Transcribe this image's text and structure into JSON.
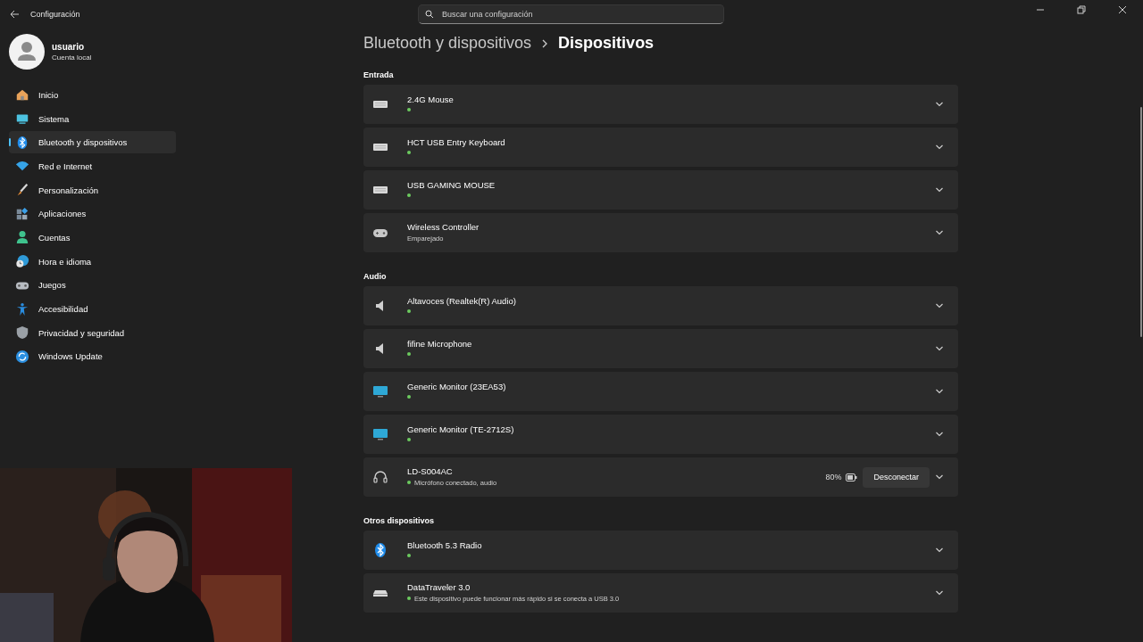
{
  "window": {
    "title": "Configuración"
  },
  "search": {
    "placeholder": "Buscar una configuración"
  },
  "account": {
    "name": "usuario",
    "type": "Cuenta local"
  },
  "sidebar": {
    "items": [
      {
        "label": "Inicio",
        "selected": false
      },
      {
        "label": "Sistema",
        "selected": false
      },
      {
        "label": "Bluetooth y dispositivos",
        "selected": true
      },
      {
        "label": "Red e Internet",
        "selected": false
      },
      {
        "label": "Personalización",
        "selected": false
      },
      {
        "label": "Aplicaciones",
        "selected": false
      },
      {
        "label": "Cuentas",
        "selected": false
      },
      {
        "label": "Hora e idioma",
        "selected": false
      },
      {
        "label": "Juegos",
        "selected": false
      },
      {
        "label": "Accesibilidad",
        "selected": false
      },
      {
        "label": "Privacidad y seguridad",
        "selected": false
      },
      {
        "label": "Windows Update",
        "selected": false
      }
    ]
  },
  "breadcrumb": [
    "Bluetooth y dispositivos",
    "Dispositivos"
  ],
  "sections": [
    {
      "title": "Entrada",
      "devices": [
        {
          "name": "2.4G Mouse",
          "kind": "keyboard",
          "connected": true
        },
        {
          "name": "HCT USB Entry Keyboard",
          "kind": "keyboard",
          "connected": true
        },
        {
          "name": "USB GAMING MOUSE",
          "kind": "keyboard",
          "connected": true
        },
        {
          "name": "Wireless Controller",
          "kind": "gamepad",
          "connected": false,
          "status": "Emparejado"
        }
      ]
    },
    {
      "title": "Audio",
      "devices": [
        {
          "name": "Altavoces (Realtek(R) Audio)",
          "kind": "speaker",
          "connected": true
        },
        {
          "name": "fifine Microphone",
          "kind": "speaker",
          "connected": true
        },
        {
          "name": "Generic Monitor (23EA53)",
          "kind": "monitor",
          "connected": true
        },
        {
          "name": "Generic Monitor (TE-2712S)",
          "kind": "monitor",
          "connected": true
        },
        {
          "name": "LD-S004AC",
          "kind": "headset",
          "connected": true,
          "status": "Micrófono conectado, audio",
          "battery": "80%",
          "action": "Desconectar"
        }
      ]
    },
    {
      "title": "Otros dispositivos",
      "devices": [
        {
          "name": "Bluetooth 5.3 Radio",
          "kind": "bluetooth",
          "connected": true
        },
        {
          "name": "DataTraveler 3.0",
          "kind": "drive",
          "connected": true,
          "status": "Este dispositivo puede funcionar más rápido si se conecta a USB 3.0"
        }
      ]
    }
  ],
  "webcam": {
    "kind": "picture"
  }
}
